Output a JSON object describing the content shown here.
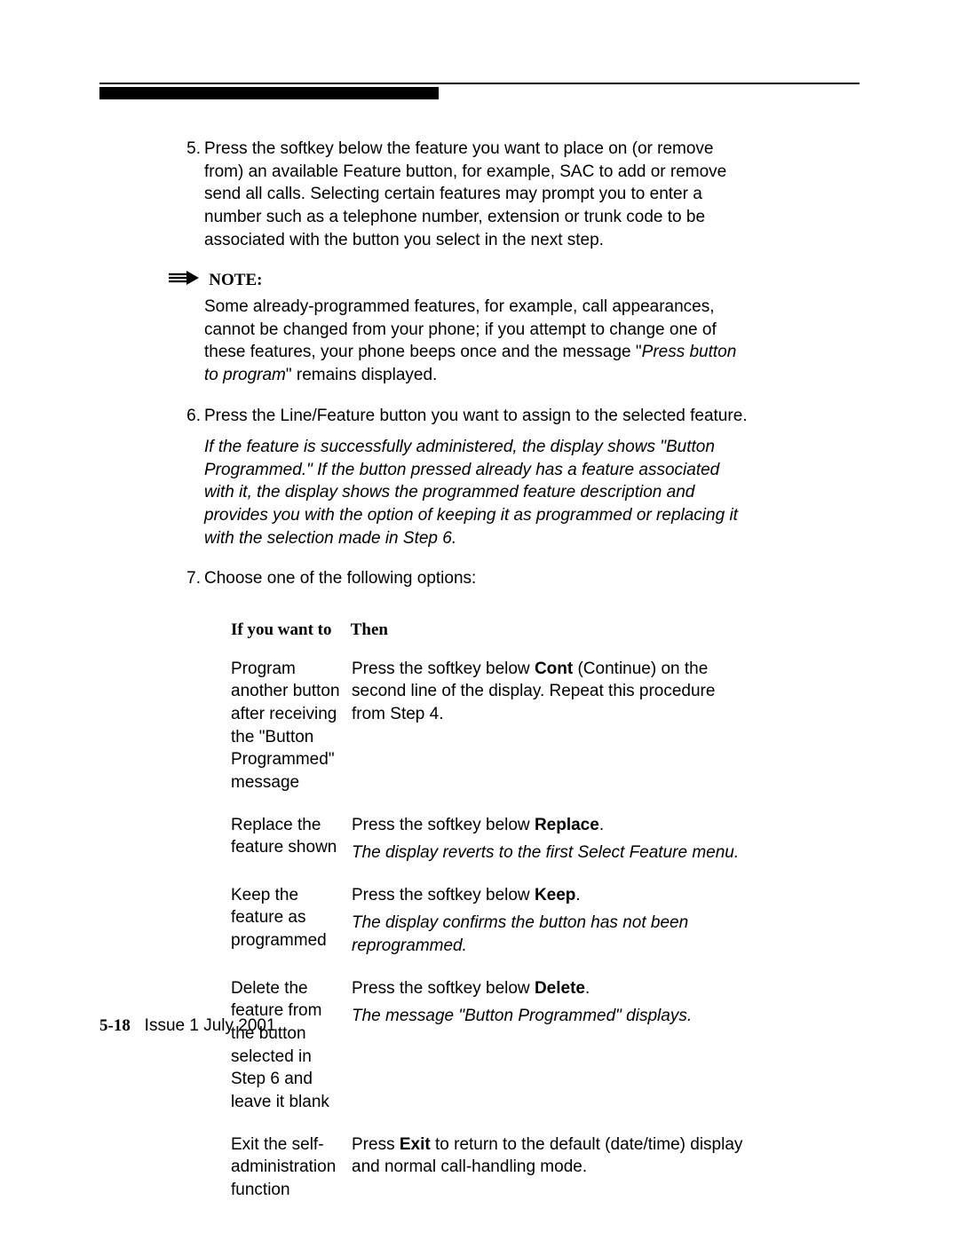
{
  "step5": {
    "num": "5.",
    "text": "Press the softkey below the feature you want to place on (or remove from) an available Feature button, for example, SAC to add or remove send all calls. Selecting certain features may prompt you to enter a number such as a telephone number, extension or trunk code to be associated with the button you select in the next step."
  },
  "note": {
    "label": "NOTE:",
    "body_pre": "Some already-programmed features, for example, call appearances, cannot be changed from your phone; if you attempt to change one of these features, your phone beeps once and the message \"",
    "body_ital": "Press button to program",
    "body_post": "\" remains displayed."
  },
  "step6": {
    "num": "6.",
    "text": "Press the Line/Feature button you want to assign to the selected feature.",
    "result": "If the feature is successfully administered, the display shows \"Button Programmed.\" If the button pressed already has a feature associated with it, the display shows the programmed feature description and provides you with the option of keeping it as programmed or replacing it with the selection made in Step 6."
  },
  "step7": {
    "num": "7.",
    "text": "Choose one of the following options:"
  },
  "table": {
    "head_if": "If you want to",
    "head_then": "Then",
    "rows": [
      {
        "if": "Program another button after receiving the \"Button Programmed\" message",
        "then_pre": "Press the softkey below ",
        "then_bold": "Cont",
        "then_post": " (Continue) on the second line of the display. Repeat this procedure from Step 4.",
        "sub": ""
      },
      {
        "if": "Replace the feature shown",
        "then_pre": "Press the softkey below ",
        "then_bold": "Replace",
        "then_post": ".",
        "sub": "The display reverts to the first Select Feature menu."
      },
      {
        "if": "Keep the feature as programmed",
        "then_pre": "Press the softkey below ",
        "then_bold": "Keep",
        "then_post": ".",
        "sub": "The display confirms the button has not been reprogrammed."
      },
      {
        "if": "Delete the feature from the button selected in Step 6 and leave it blank",
        "then_pre": "Press the softkey below ",
        "then_bold": "Delete",
        "then_post": ".",
        "sub": "The message \"Button Programmed\" displays."
      },
      {
        "if": "Exit the self-adminis­tration function",
        "then_pre": "Press ",
        "then_bold": "Exit",
        "then_post": " to return to the default (date/time) display and normal call-handling mode.",
        "sub": ""
      }
    ]
  },
  "footer": {
    "page": "5-18",
    "issue": "Issue  1   July 2001"
  }
}
